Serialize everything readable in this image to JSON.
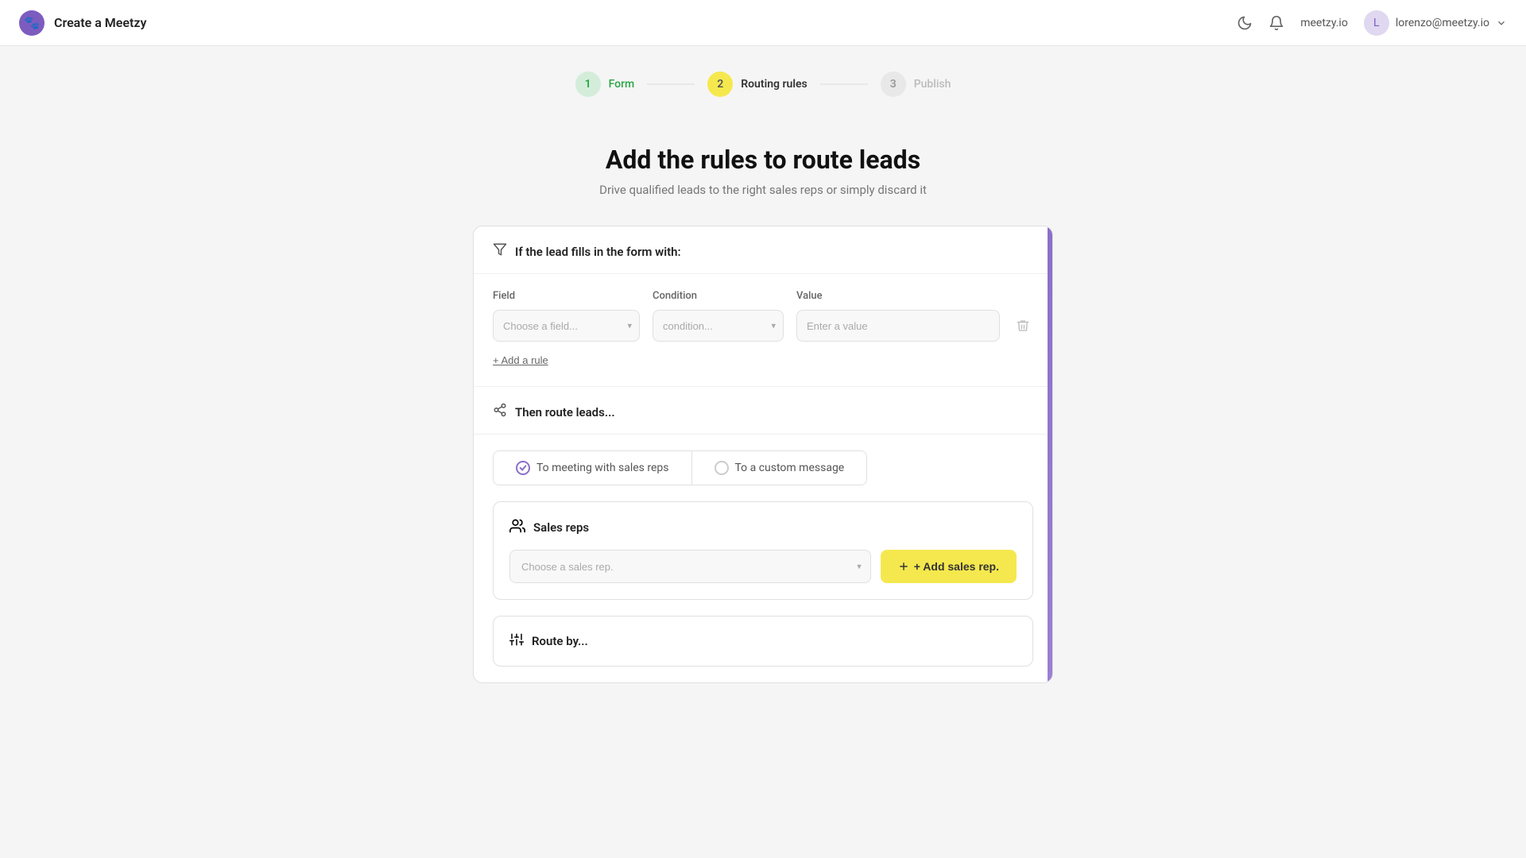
{
  "app": {
    "title": "Create a Meetzy",
    "logo": "🐾"
  },
  "navbar": {
    "site": "meetzy.io",
    "user_email": "lorenzo@meetzy.io",
    "moon_icon": "🌙",
    "bell_icon": "🔔"
  },
  "stepper": {
    "steps": [
      {
        "id": 1,
        "label": "Form",
        "state": "done"
      },
      {
        "id": 2,
        "label": "Routing rules",
        "state": "active"
      },
      {
        "id": 3,
        "label": "Publish",
        "state": "inactive"
      }
    ]
  },
  "page": {
    "title": "Add the rules to route leads",
    "subtitle": "Drive qualified leads to the right sales reps or simply discard it"
  },
  "filter_section": {
    "icon": "filter",
    "title": "If the lead fills in the form with:",
    "field_label": "Field",
    "condition_label": "Condition",
    "value_label": "Value",
    "field_placeholder": "Choose a field...",
    "condition_placeholder": "condition...",
    "value_placeholder": "Enter a value",
    "add_rule_label": "+ Add a rule"
  },
  "route_section": {
    "icon": "share",
    "title": "Then route leads...",
    "options": [
      {
        "id": "meeting",
        "label": "To meeting with sales reps",
        "selected": true
      },
      {
        "id": "custom",
        "label": "To a custom message",
        "selected": false
      }
    ]
  },
  "sales_reps": {
    "icon": "people",
    "title": "Sales reps",
    "select_placeholder": "Choose a sales rep.",
    "add_button_label": "+ Add sales rep."
  },
  "route_by": {
    "icon": "sliders",
    "title": "Route by..."
  }
}
